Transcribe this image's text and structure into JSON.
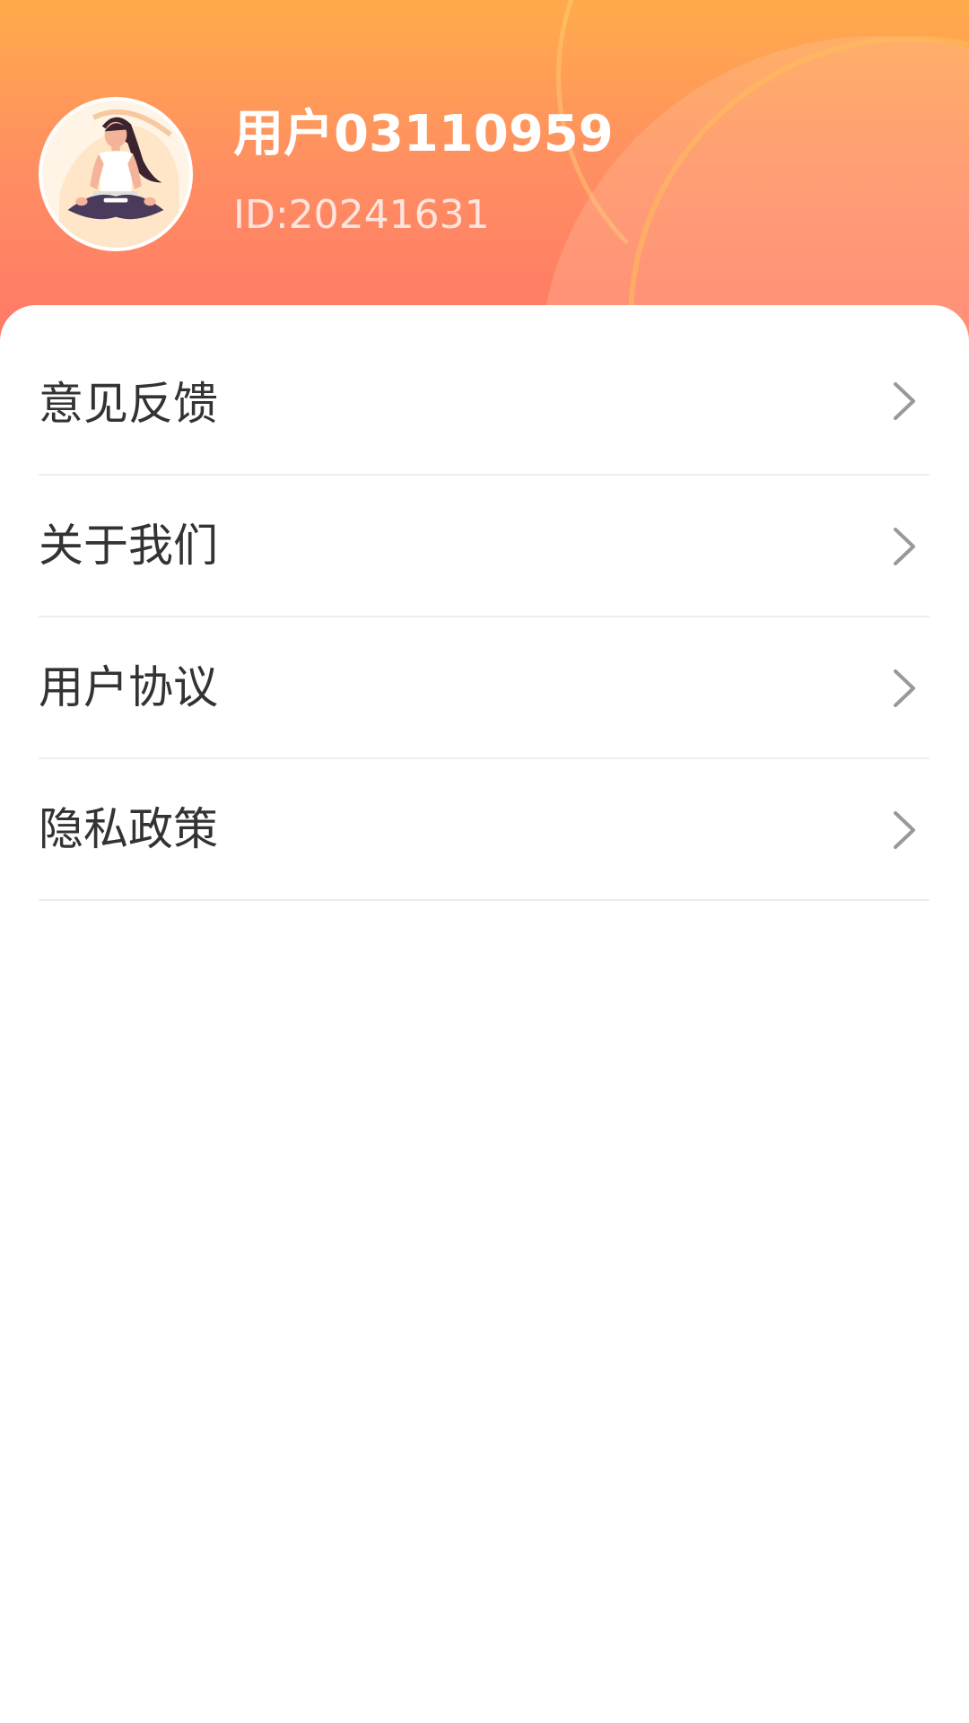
{
  "profile": {
    "name": "用户03110959",
    "id_text": "ID:20241631",
    "avatar_icon": "meditating-woman-avatar"
  },
  "menu": {
    "items": [
      {
        "label": "意见反馈",
        "icon": "chevron-right-icon"
      },
      {
        "label": "关于我们",
        "icon": "chevron-right-icon"
      },
      {
        "label": "用户协议",
        "icon": "chevron-right-icon"
      },
      {
        "label": "隐私政策",
        "icon": "chevron-right-icon"
      }
    ]
  },
  "colors": {
    "header_top": "#ffab4a",
    "header_bottom": "#ff7468",
    "label_text": "#333333",
    "chevron": "#999999",
    "divider": "#eeeeee"
  }
}
